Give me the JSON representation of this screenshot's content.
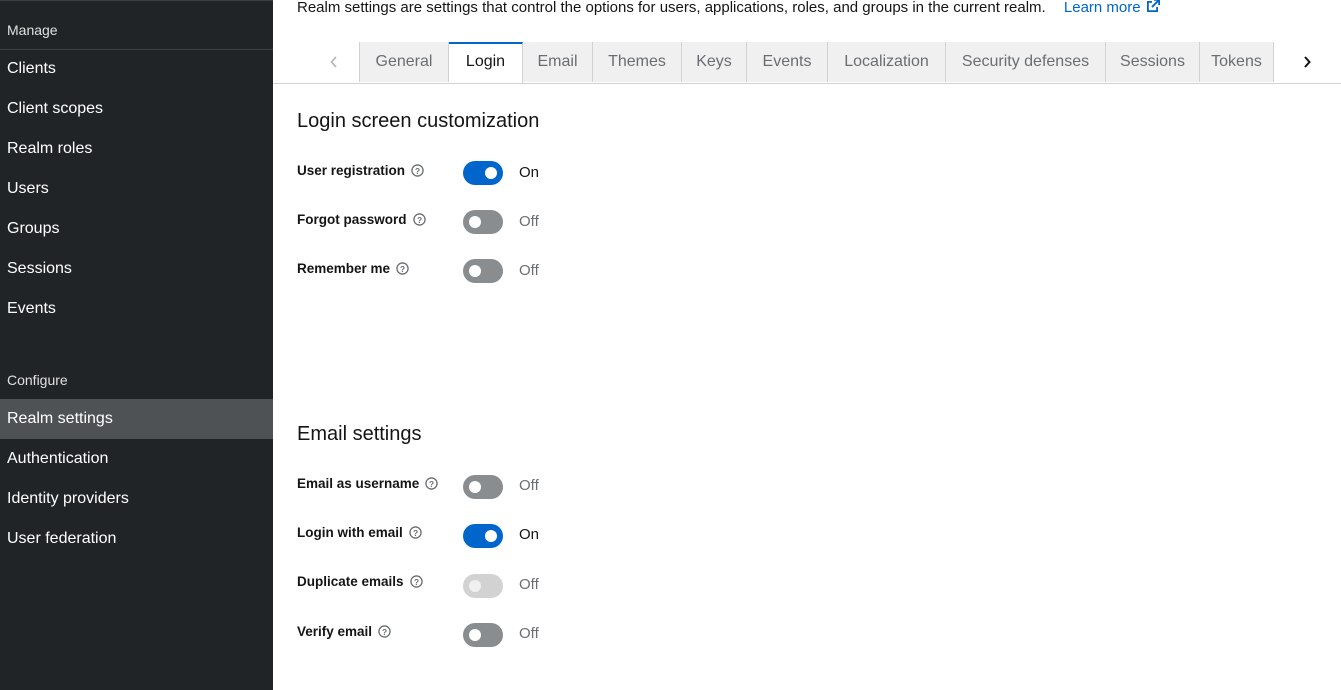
{
  "sidebar": {
    "manage_heading": "Manage",
    "manage_items": [
      {
        "label": "Clients"
      },
      {
        "label": "Client scopes"
      },
      {
        "label": "Realm roles"
      },
      {
        "label": "Users"
      },
      {
        "label": "Groups"
      },
      {
        "label": "Sessions"
      },
      {
        "label": "Events"
      }
    ],
    "configure_heading": "Configure",
    "configure_items": [
      {
        "label": "Realm settings",
        "active": true
      },
      {
        "label": "Authentication"
      },
      {
        "label": "Identity providers"
      },
      {
        "label": "User federation"
      }
    ]
  },
  "header": {
    "description": "Realm settings are settings that control the options for users, applications, roles, and groups in the current realm.",
    "learn_more": "Learn more"
  },
  "tabs": [
    {
      "label": "General"
    },
    {
      "label": "Login",
      "active": true
    },
    {
      "label": "Email"
    },
    {
      "label": "Themes"
    },
    {
      "label": "Keys"
    },
    {
      "label": "Events"
    },
    {
      "label": "Localization"
    },
    {
      "label": "Security defenses"
    },
    {
      "label": "Sessions"
    },
    {
      "label": "Tokens"
    }
  ],
  "login_section": {
    "title": "Login screen customization",
    "fields": [
      {
        "label": "User registration",
        "state": "On"
      },
      {
        "label": "Forgot password",
        "state": "Off"
      },
      {
        "label": "Remember me",
        "state": "Off"
      }
    ]
  },
  "email_section": {
    "title": "Email settings",
    "fields": [
      {
        "label": "Email as username",
        "state": "Off"
      },
      {
        "label": "Login with email",
        "state": "On"
      },
      {
        "label": "Duplicate emails",
        "state": "Off",
        "disabled": true
      },
      {
        "label": "Verify email",
        "state": "Off"
      }
    ]
  },
  "colors": {
    "sidebar_bg": "#212427",
    "active_item_bg": "#4f5255",
    "accent": "#0066cc",
    "switch_off": "#8a8d90"
  }
}
